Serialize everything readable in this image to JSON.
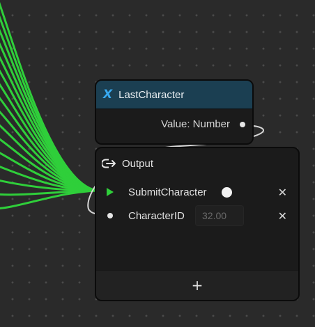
{
  "variable_node": {
    "title": "LastCharacter",
    "icon": "x-variable-icon",
    "output_label": "Value: Number"
  },
  "output_node": {
    "title": "Output",
    "icon": "output-arrow-icon",
    "pins": [
      {
        "label": "SubmitCharacter",
        "type": "exec",
        "toggle": "on"
      },
      {
        "label": "CharacterID",
        "type": "number",
        "placeholder": "32.00"
      }
    ],
    "add_label": "+",
    "remove_label": "✕"
  },
  "colors": {
    "canvas": "#2a2a2a",
    "wire_exec": "#2fcf3a",
    "wire_data": "#d6d6d6",
    "variable_header": "#1b3f52"
  }
}
